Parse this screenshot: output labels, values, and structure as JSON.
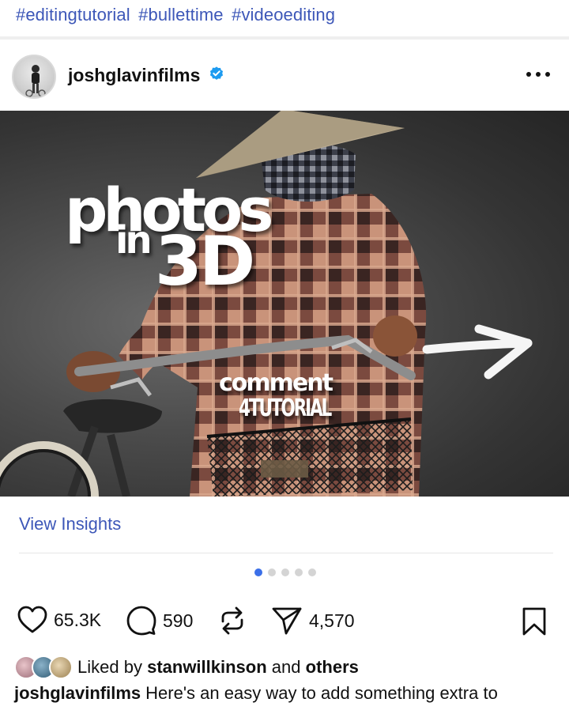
{
  "hashtags": [
    "#editingtutorial",
    "#bullettime",
    "#videoediting"
  ],
  "post": {
    "username": "joshglavinfilms",
    "verified": true,
    "more_icon": "more-horizontal-icon",
    "image_overlay": {
      "line1": "photos",
      "line2": "in",
      "line3": "3D",
      "cta1": "comment",
      "cta2": "4TUTORIAL"
    },
    "insights_label": "View Insights",
    "carousel": {
      "total": 5,
      "active": 1
    },
    "actions": {
      "likes": "65.3K",
      "comments": "590",
      "shares": "4,570"
    },
    "liked_by": {
      "prefix": "Liked by",
      "user": "stanwillkinson",
      "connector": "and",
      "others": "others"
    },
    "caption": {
      "username": "joshglavinfilms",
      "text": "Here's an easy way to add something extra to"
    }
  },
  "colors": {
    "link_blue": "#3d57b8",
    "verified_blue": "#1d9bf0",
    "active_dot": "#3b6fe8"
  }
}
